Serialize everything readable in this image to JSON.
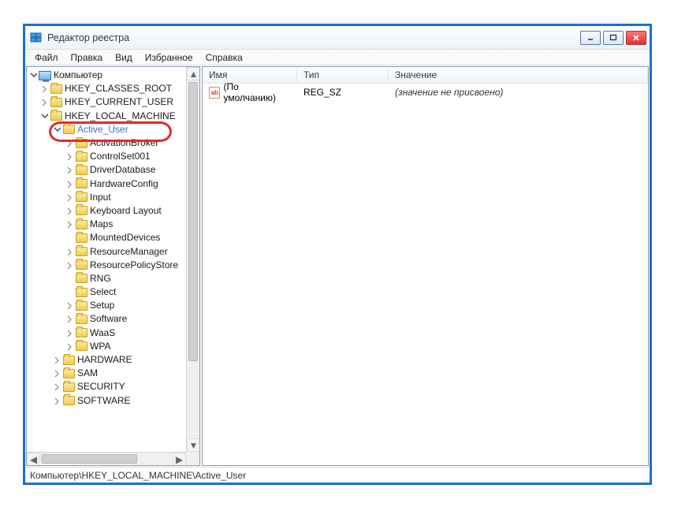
{
  "window": {
    "title": "Редактор реестра"
  },
  "menu": {
    "file": "Файл",
    "edit": "Правка",
    "view": "Вид",
    "favorites": "Избранное",
    "help": "Справка"
  },
  "tree": {
    "root": "Компьютер",
    "hives": {
      "hkcr": "HKEY_CLASSES_ROOT",
      "hkcu": "HKEY_CURRENT_USER",
      "hklm": "HKEY_LOCAL_MACHINE"
    },
    "selected": "Active_User",
    "hklm_children": [
      "ActivationBroker",
      "ControlSet001",
      "DriverDatabase",
      "HardwareConfig",
      "Input",
      "Keyboard Layout",
      "Maps",
      "MountedDevices",
      "ResourceManager",
      "ResourcePolicyStore",
      "RNG",
      "Select",
      "Setup",
      "Software",
      "WaaS",
      "WPA"
    ],
    "hklm_after": [
      "HARDWARE",
      "SAM",
      "SECURITY",
      "SOFTWARE"
    ]
  },
  "list": {
    "columns": {
      "name": "Имя",
      "type": "Тип",
      "value": "Значение"
    },
    "row": {
      "name": "(По умолчанию)",
      "type": "REG_SZ",
      "value": "(значение не присвоено)"
    },
    "value_icon_text": "ab"
  },
  "statusbar": {
    "path": "Компьютер\\HKEY_LOCAL_MACHINE\\Active_User"
  }
}
